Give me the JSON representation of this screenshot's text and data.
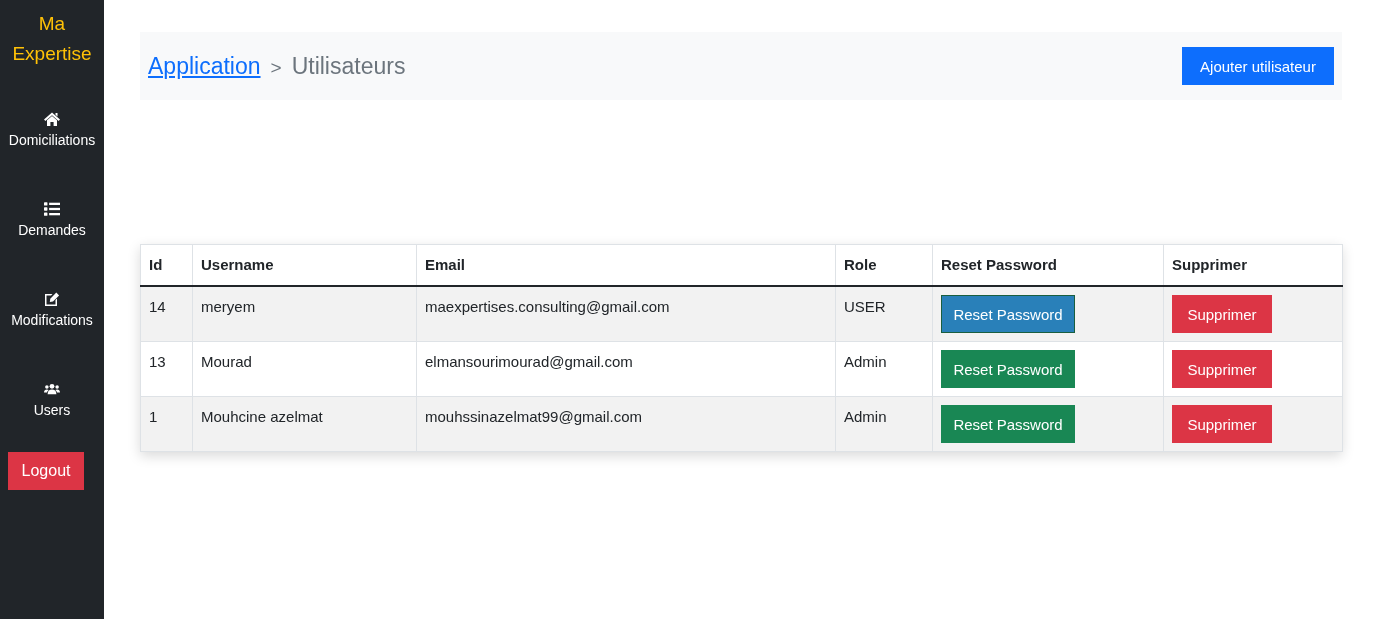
{
  "sidebar": {
    "brand": "Ma Expertise",
    "items": [
      {
        "label": "Domiciliations"
      },
      {
        "label": "Demandes"
      },
      {
        "label": "Modifications"
      },
      {
        "label": "Users"
      }
    ],
    "logout": "Logout"
  },
  "header": {
    "breadcrumb": [
      {
        "label": "Application",
        "kind": "link"
      },
      {
        "label": ">",
        "kind": "separator"
      },
      {
        "label": "Utilisateurs",
        "kind": "current"
      }
    ],
    "add_button": "Ajouter utilisateur"
  },
  "table": {
    "columns": [
      "Id",
      "Username",
      "Email",
      "Role",
      "Reset Password",
      "Supprimer"
    ],
    "rows": [
      {
        "id": "14",
        "username": "meryem",
        "email": "maexpertises.consulting@gmail.com",
        "role": "USER",
        "reset": {
          "label": "Reset Password",
          "highlighted": true
        },
        "delete": "Supprimer"
      },
      {
        "id": "13",
        "username": "Mourad",
        "email": "elmansourimourad@gmail.com",
        "role": "Admin",
        "reset": {
          "label": "Reset Password",
          "highlighted": false
        },
        "delete": "Supprimer"
      },
      {
        "id": "1",
        "username": "Mouhcine azelmat",
        "email": "mouhssinazelmat99@gmail.com",
        "role": "Admin",
        "reset": {
          "label": "Reset Password",
          "highlighted": false
        },
        "delete": "Supprimer"
      }
    ]
  }
}
